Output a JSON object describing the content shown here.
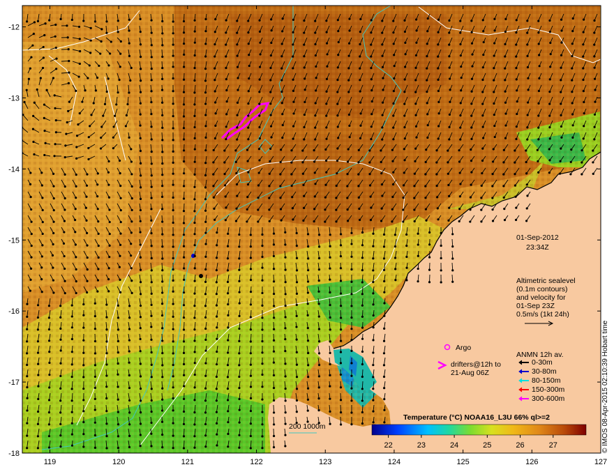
{
  "map": {
    "lon_range": [
      118.6,
      127.0
    ],
    "lat_range": [
      -18.0,
      -11.7
    ],
    "lon_ticks": [
      "119",
      "120",
      "121",
      "122",
      "123",
      "124",
      "125",
      "126",
      "127"
    ],
    "lat_ticks": [
      "-12",
      "-13",
      "-14",
      "-15",
      "-16",
      "-17",
      "-18"
    ],
    "date": "01-Sep-2012",
    "time": "23:34Z",
    "altimetry_lines": [
      "Altimetric sealevel",
      "(0.1m contours)",
      "and velocity for",
      "01-Sep 23Z",
      "0.5m/s (1kt 24h)"
    ],
    "argo_label": "Argo",
    "drifters_lines": [
      "drifters@12h to",
      "21-Aug 06Z"
    ],
    "anmn_title": "ANMN 12h av.",
    "anmn_items": [
      {
        "label": "0-30m",
        "color": "#000000"
      },
      {
        "label": "30-80m",
        "color": "#0000cc"
      },
      {
        "label": "80-150m",
        "color": "#00e0e0"
      },
      {
        "label": "150-300m",
        "color": "#ff0000"
      },
      {
        "label": "300-600m",
        "color": "#ff00ff"
      }
    ],
    "isobath_label": "200  1000m",
    "colorbar_title": "Temperature (°C) NOAA16_L3U 66% ql>=2",
    "colorbar_ticks": [
      "22",
      "23",
      "24",
      "25",
      "26",
      "27"
    ],
    "colorbar_range": [
      21.5,
      28
    ],
    "credit": "© IMOS 08-Apr-2015 02:10:39 Hobart time",
    "colors": {
      "land": "#f8c9a0",
      "warm": "#c8761c",
      "isobath": "#40c8c0",
      "contour": "#ffffff",
      "drifter": "#ff00ff"
    }
  }
}
